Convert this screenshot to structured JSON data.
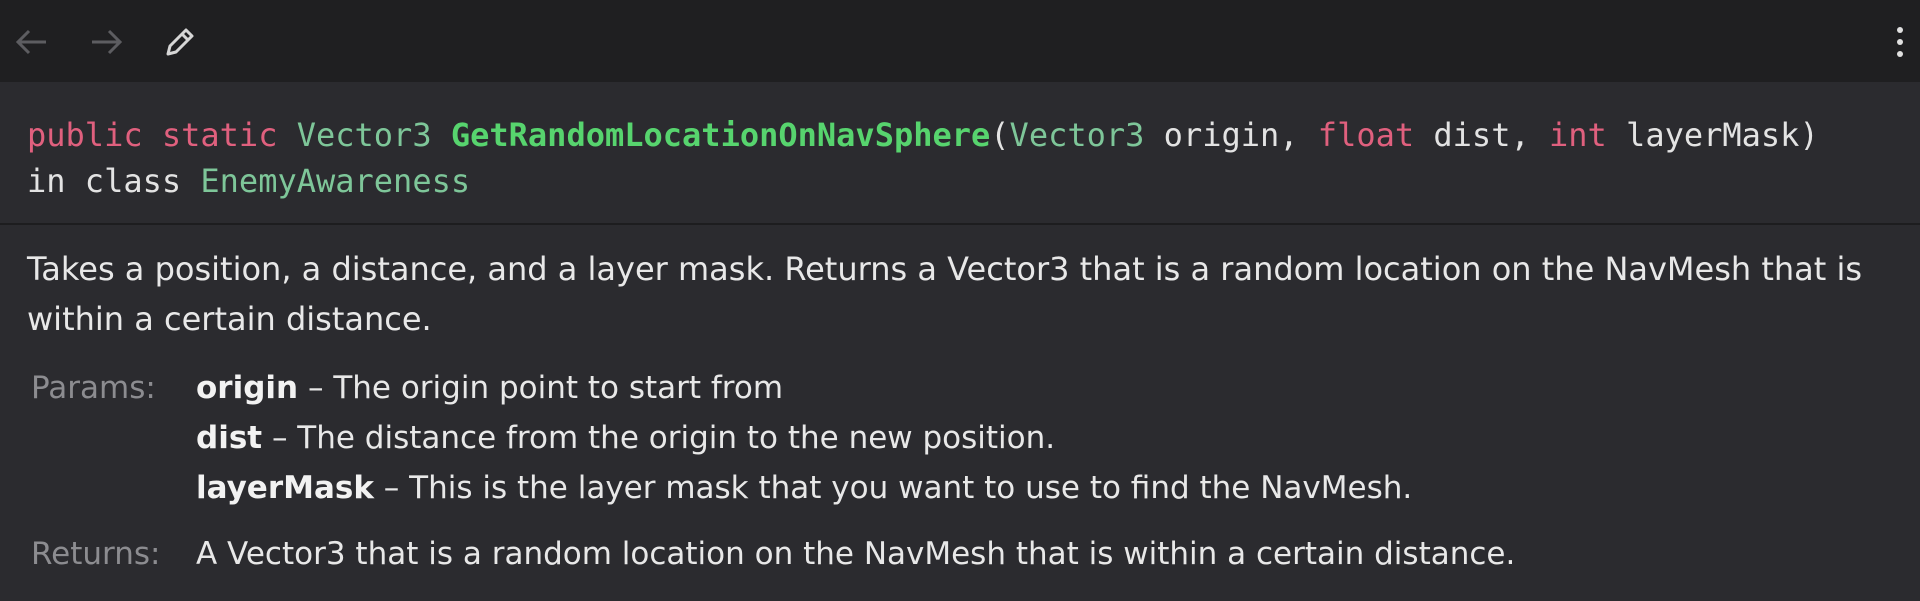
{
  "toolbar": {
    "back_icon": "arrow-left-icon",
    "forward_icon": "arrow-right-icon",
    "edit_icon": "pencil-icon",
    "more_icon": "vertical-ellipsis-icon"
  },
  "signature": {
    "kw_public": "public",
    "kw_static": "static",
    "return_type": "Vector3",
    "method_name": "GetRandomLocationOnNavSphere",
    "open_paren": "(",
    "param1_type": "Vector3",
    "param1_name": " origin, ",
    "param2_type": "float",
    "param2_name": " dist, ",
    "param3_type": "int",
    "param3_name": " layerMask)",
    "in_class_prefix": "in class ",
    "class_name": "EnemyAwareness"
  },
  "description": "Takes a position, a distance, and a layer mask. Returns a Vector3 that is a random location on the NavMesh that is within a certain distance.",
  "params_label": "Params:",
  "params": [
    {
      "name": "origin",
      "text": " – The origin point to start from"
    },
    {
      "name": "dist",
      "text": " – The distance from the origin to the new position."
    },
    {
      "name": "layerMask",
      "text": " – This is the layer mask that you want to use to find the NavMesh."
    }
  ],
  "returns_label": "Returns:",
  "returns_text": "A Vector3 that is a random location on the NavMesh that is within a certain distance.",
  "colors": {
    "keyword": "#e0607e",
    "type": "#7ec699",
    "method": "#57d46e",
    "background": "#2b2b2f",
    "toolbar": "#1f1f21"
  }
}
